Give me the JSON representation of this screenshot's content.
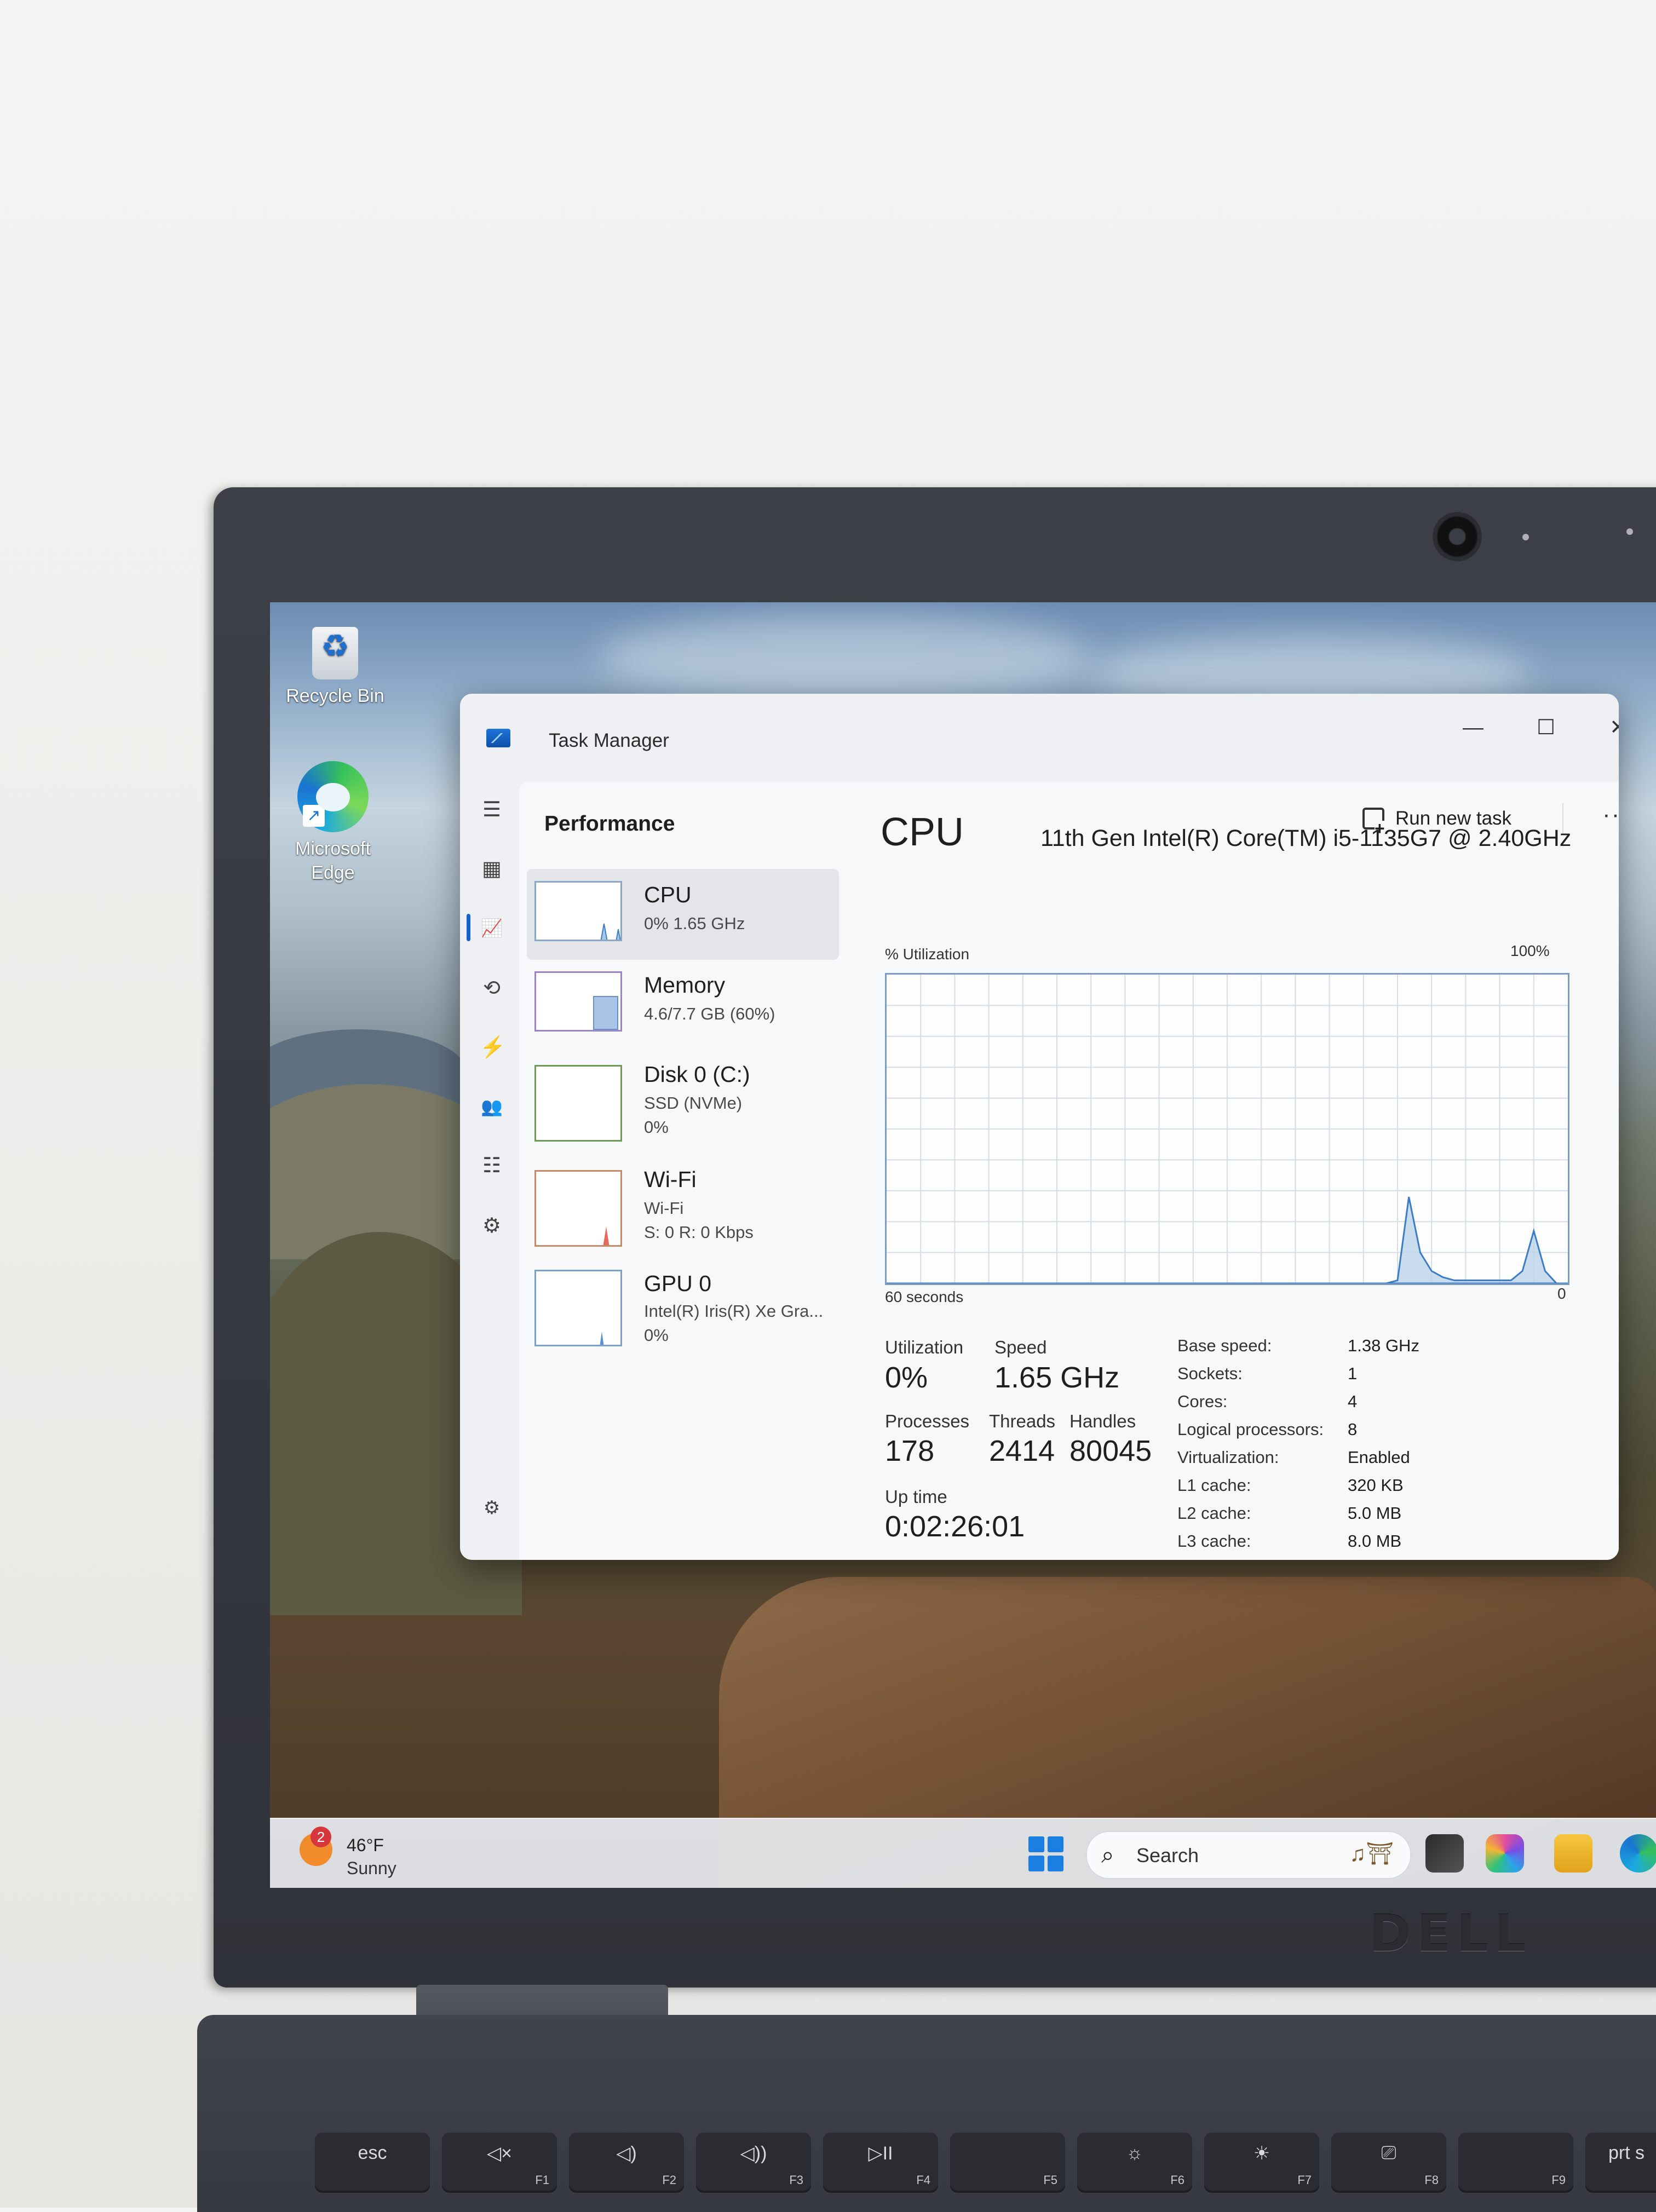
{
  "desktop": {
    "icons": [
      {
        "label": "Recycle Bin",
        "icon": "recycle-bin-icon"
      },
      {
        "label": "Microsoft Edge",
        "icon": "edge-icon"
      }
    ]
  },
  "window": {
    "title": "Task Manager",
    "controls": {
      "minimize": "—",
      "maximize": "☐",
      "close": "✕"
    }
  },
  "toolbar": {
    "section_title": "Performance",
    "run_new_task": "Run new task",
    "more": "···"
  },
  "nav": [
    {
      "name": "hamburger-menu",
      "icon": "☰"
    },
    {
      "name": "processes",
      "icon": "▦"
    },
    {
      "name": "performance",
      "icon": "📈",
      "active": true
    },
    {
      "name": "app-history",
      "icon": "⟲"
    },
    {
      "name": "startup-apps",
      "icon": "⚡"
    },
    {
      "name": "users",
      "icon": "👥"
    },
    {
      "name": "details",
      "icon": "☷"
    },
    {
      "name": "services",
      "icon": "⚙"
    },
    {
      "name": "settings",
      "icon": "⚙"
    }
  ],
  "sidebar": {
    "items": [
      {
        "name": "CPU",
        "sub1": "0% 1.65 GHz",
        "sub2": "",
        "sub3": "",
        "active": true
      },
      {
        "name": "Memory",
        "sub1": "4.6/7.7 GB (60%)",
        "sub2": "",
        "sub3": ""
      },
      {
        "name": "Disk 0 (C:)",
        "sub1": "SSD (NVMe)",
        "sub2": "0%",
        "sub3": ""
      },
      {
        "name": "Wi-Fi",
        "sub1": "Wi-Fi",
        "sub2": "S: 0 R: 0 Kbps",
        "sub3": ""
      },
      {
        "name": "GPU 0",
        "sub1": "Intel(R) Iris(R) Xe Gra...",
        "sub2": "0%",
        "sub3": ""
      }
    ],
    "memory_fill_fraction": 0.6
  },
  "cpu": {
    "heading": "CPU",
    "model": "11th Gen Intel(R) Core(TM) i5-1135G7 @ 2.40GHz",
    "graph_label": "% Utilization",
    "graph_max": "100%",
    "graph_time": "60 seconds",
    "graph_min": "0",
    "stats": {
      "utilization_label": "Utilization",
      "utilization": "0%",
      "speed_label": "Speed",
      "speed": "1.65 GHz",
      "processes_label": "Processes",
      "processes": "178",
      "threads_label": "Threads",
      "threads": "2414",
      "handles_label": "Handles",
      "handles": "80045",
      "uptime_label": "Up time",
      "uptime": "0:02:26:01"
    },
    "specs": [
      {
        "label": "Base speed:",
        "value": "1.38 GHz"
      },
      {
        "label": "Sockets:",
        "value": "1"
      },
      {
        "label": "Cores:",
        "value": "4"
      },
      {
        "label": "Logical processors:",
        "value": "8"
      },
      {
        "label": "Virtualization:",
        "value": "Enabled"
      },
      {
        "label": "L1 cache:",
        "value": "320 KB"
      },
      {
        "label": "L2 cache:",
        "value": "5.0 MB"
      },
      {
        "label": "L3 cache:",
        "value": "8.0 MB"
      }
    ]
  },
  "chart_data": {
    "type": "area",
    "x_unit": "seconds ago",
    "xlim": [
      60,
      0
    ],
    "ylim": [
      0,
      100
    ],
    "grid": true,
    "series": [
      {
        "x": [
          60,
          50,
          40,
          30,
          20,
          16,
          15,
          14,
          13,
          12,
          11,
          10,
          9,
          7,
          6,
          5,
          4,
          3,
          2,
          1,
          0
        ],
        "values": [
          0,
          0,
          0,
          0,
          0,
          0,
          1,
          28,
          10,
          4,
          2,
          1,
          1,
          1,
          1,
          1,
          4,
          17,
          4,
          0,
          0
        ]
      }
    ]
  },
  "taskbar": {
    "weather_badge": "2",
    "temperature": "46°F",
    "condition": "Sunny",
    "search_placeholder": "Search"
  },
  "laptop": {
    "brand": "DELL",
    "keys": [
      {
        "label": "esc",
        "fn": ""
      },
      {
        "label": "◁×",
        "fn": "F1"
      },
      {
        "label": "◁)",
        "fn": "F2"
      },
      {
        "label": "◁))",
        "fn": "F3"
      },
      {
        "label": "▷II",
        "fn": "F4"
      },
      {
        "label": "",
        "fn": "F5"
      },
      {
        "label": "☼",
        "fn": "F6"
      },
      {
        "label": "☀",
        "fn": "F7"
      },
      {
        "label": "⎚",
        "fn": "F8"
      },
      {
        "label": "",
        "fn": "F9"
      },
      {
        "label": "prt s",
        "fn": ""
      }
    ]
  }
}
